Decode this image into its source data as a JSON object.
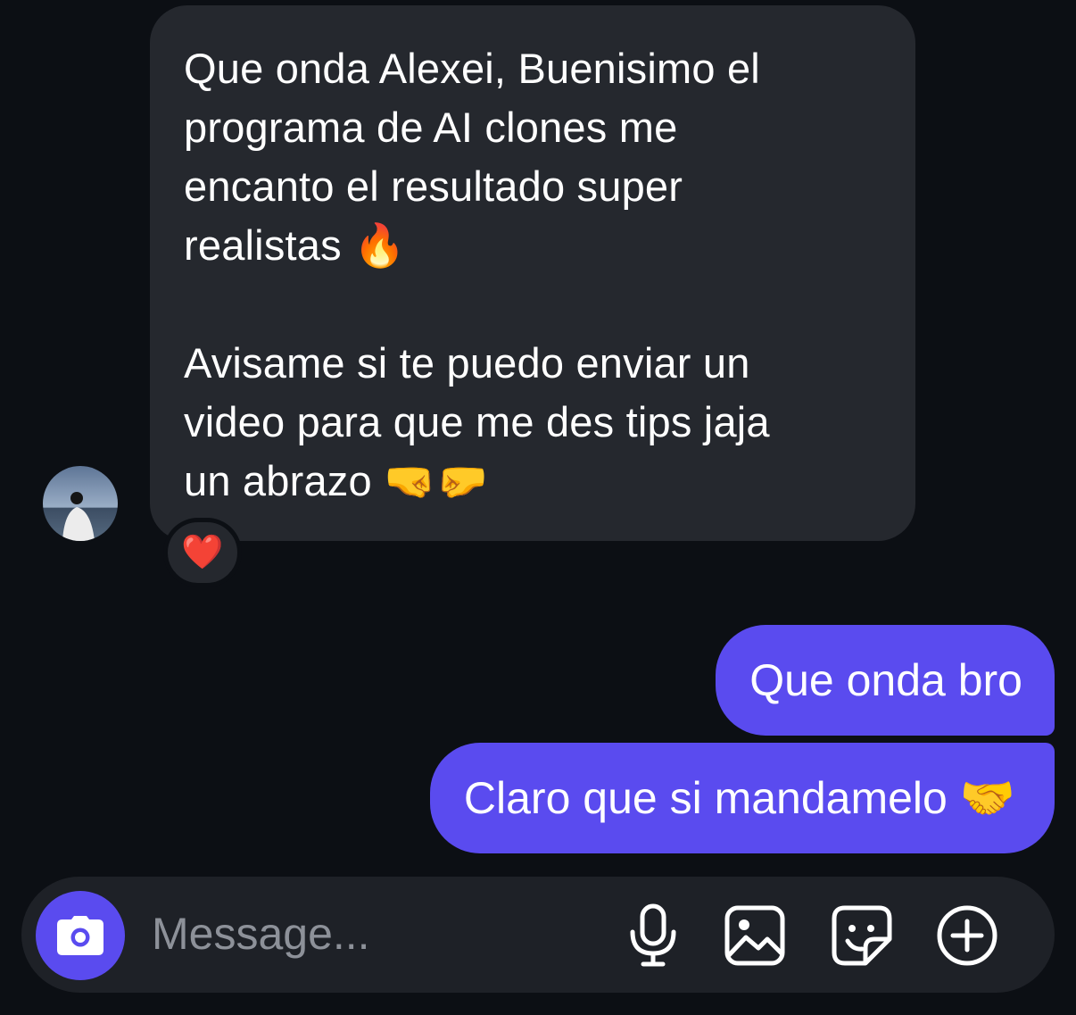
{
  "incoming": {
    "text": "Que onda Alexei, Buenisimo el\nprograma de AI clones me\nencanto el resultado super\nrealistas 🔥\n\nAvisame si te puedo enviar un\nvideo para que me des tips jaja\nun abrazo 🤜🤛",
    "reaction": "❤️"
  },
  "outgoing": [
    {
      "text": "Que onda bro"
    },
    {
      "text": "Claro que si mandamelo 🤝"
    }
  ],
  "composer": {
    "placeholder": "Message..."
  },
  "colors": {
    "background": "#0c0f14",
    "incoming_bubble": "#25282e",
    "outgoing_bubble": "#5a4bef",
    "composer": "#1e2127",
    "placeholder": "#8d9199"
  },
  "icons": [
    "camera-icon",
    "microphone-icon",
    "gallery-icon",
    "sticker-icon",
    "plus-icon"
  ]
}
